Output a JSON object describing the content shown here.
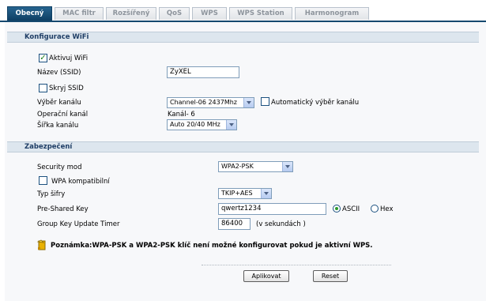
{
  "tabs": [
    {
      "label": "Obecný",
      "active": true
    },
    {
      "label": "MAC filtr",
      "active": false
    },
    {
      "label": "Rozšířený",
      "active": false
    },
    {
      "label": "QoS",
      "active": false
    },
    {
      "label": "WPS",
      "active": false
    },
    {
      "label": "WPS Station",
      "active": false
    },
    {
      "label": "Harmonogram",
      "active": false
    }
  ],
  "wifi": {
    "section_title": "Konfigurace WiFi",
    "enable_label": "Aktivuj WiFi",
    "enable_checked": true,
    "ssid_label": "Název (SSID)",
    "ssid_value": "ZyXEL",
    "hide_ssid_label": "Skryj SSID",
    "hide_ssid_checked": false,
    "channel_label": "Výběr kanálu",
    "channel_value": "Channel-06 2437Mhz",
    "auto_channel_label": "Automatický výběr kanálu",
    "auto_channel_checked": false,
    "op_channel_label": "Operační kanál",
    "op_channel_value": "Kanál- 6",
    "width_label": "Šířka kanálu",
    "width_value": "Auto 20/40 MHz"
  },
  "security": {
    "section_title": "Zabezpečení",
    "mode_label": "Security mod",
    "mode_value": "WPA2-PSK",
    "wpa_compat_label": "WPA kompatibilní",
    "wpa_compat_checked": false,
    "cipher_label": "Typ šifry",
    "cipher_value": "TKIP+AES",
    "psk_label": "Pre-Shared Key",
    "psk_value": "qwertz1234",
    "ascii_label": "ASCII",
    "hex_label": "Hex",
    "key_format_selected": "ASCII",
    "timer_label": "Group Key Update Timer",
    "timer_value": "86400",
    "timer_unit": "(v sekundách )"
  },
  "note": {
    "prefix": "Poznámka:",
    "text": "WPA-PSK a WPA2-PSK klíč není možné konfigurovat pokud je aktivní WPS."
  },
  "buttons": {
    "apply": "Aplikovat",
    "reset": "Reset"
  },
  "colors": {
    "tab_active": "#15496f",
    "section_bg": "#dde6ee",
    "section_text": "#1f3e66",
    "check": "#1a7d1a"
  }
}
